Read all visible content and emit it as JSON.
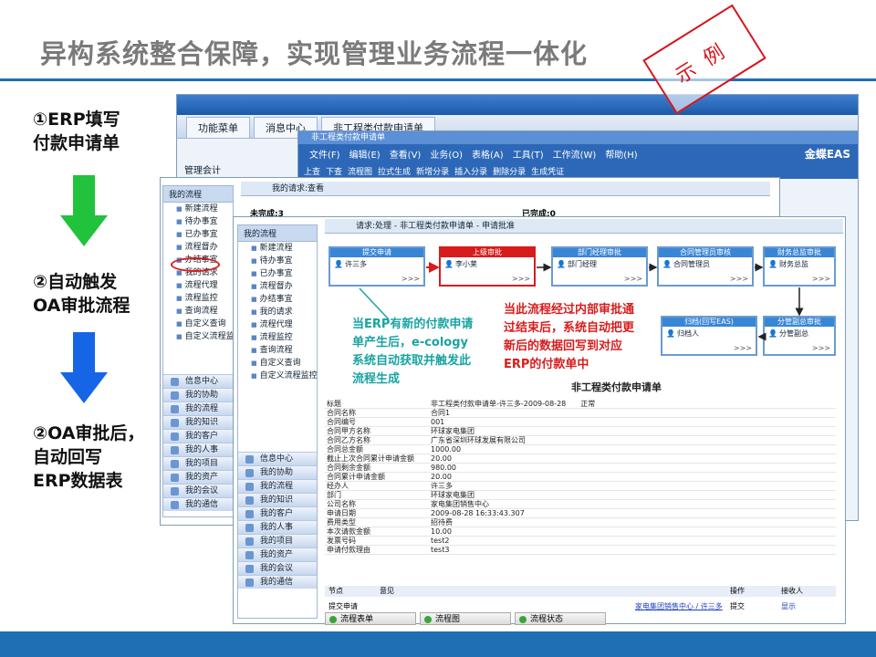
{
  "title": "异构系统整合保障，实现管理业务流程一体化",
  "stamp": "示例",
  "steps": [
    {
      "line1": "①ERP填写",
      "line2": "付款申请单"
    },
    {
      "line1": "②自动触发",
      "line2": "OA审批流程"
    },
    {
      "line1": "②OA审批后，",
      "line2": "自动回写",
      "line3": "ERP数据表"
    }
  ],
  "colors": {
    "accent": "#1f6fb5",
    "stamp": "#d8141b",
    "arrow_green": "#21c23c",
    "arrow_blue": "#1565e6"
  },
  "eas": {
    "tab_function": "功能菜单",
    "tab_message": "消息中心",
    "tab_form": "非工程类付款申请单",
    "inner_title": "非工程类付款申请单",
    "brand": "金蝶EAS",
    "section": "管理会计",
    "menu": [
      "文件(F)",
      "编辑(E)",
      "查看(V)",
      "业务(O)",
      "表格(A)",
      "工具(T)",
      "工作流(W)",
      "帮助(H)"
    ],
    "toolbar": [
      "上查",
      "下查",
      "流程图",
      "拉式生成",
      "新增分录",
      "插入分录",
      "删除分录",
      "生成凭证"
    ]
  },
  "oa_back": {
    "header": "我的请求:查看",
    "incomplete": "未完成:3",
    "complete": "已完成:0",
    "tree_title": "我的流程",
    "tree": [
      "新建流程",
      "待办事宜",
      "已办事宜",
      "流程督办",
      "办结事宜",
      "我的请求",
      "流程代理",
      "流程监控",
      "查询流程",
      "自定义查询",
      "自定义流程监控"
    ],
    "nav": [
      "信息中心",
      "我的协助",
      "我的流程",
      "我的知识",
      "我的客户",
      "我的人事",
      "我的项目",
      "我的资产",
      "我的会议",
      "我的通信"
    ]
  },
  "oa_front": {
    "header": "请求:处理 - 非工程类付款申请单 - 申请批准",
    "tree_title": "我的流程",
    "tree": [
      "新建流程",
      "待办事宜",
      "已办事宜",
      "流程督办",
      "办结事宜",
      "我的请求",
      "流程代理",
      "流程监控",
      "查询流程",
      "自定义查询",
      "自定义流程监控"
    ],
    "nav": [
      "信息中心",
      "我的协助",
      "我的流程",
      "我的知识",
      "我的客户",
      "我的人事",
      "我的项目",
      "我的资产",
      "我的会议",
      "我的通信"
    ],
    "nodes": [
      {
        "title": "提交申请",
        "person": "许三多"
      },
      {
        "title": "上级审批",
        "person": "李小莱"
      },
      {
        "title": "部门经理审批",
        "person": "部门经理"
      },
      {
        "title": "合同管理员审核",
        "person": "合同管理员"
      },
      {
        "title": "财务总监审批",
        "person": "财务总监"
      },
      {
        "title": "分管副总审批",
        "person": "分管副总"
      },
      {
        "title": "归档(回写EAS)",
        "person": "归档人"
      }
    ],
    "anno_left": [
      "当ERP有新的付款申请",
      "单产生后，e-cology",
      "系统自动获取并触发此",
      "流程生成"
    ],
    "anno_right": [
      "当此流程经过内部审批通",
      "过结束后，系统自动把更",
      "新后的数据回写到对应",
      "ERP的付款单中"
    ],
    "form_title": "非工程类付款申请单",
    "fields": [
      {
        "k": "标题",
        "v": "非工程类付款申请单-许三多-2009-08-28　　正常"
      },
      {
        "k": "合同名称",
        "v": "合同1"
      },
      {
        "k": "合同编号",
        "v": "001"
      },
      {
        "k": "合同甲方名称",
        "v": "环球家电集团"
      },
      {
        "k": "合同乙方名称",
        "v": "广东省深圳环球发展有限公司"
      },
      {
        "k": "合同总金额",
        "v": "1000.00"
      },
      {
        "k": "截止上次合同累计申请金额",
        "v": "20.00"
      },
      {
        "k": "合同剩余金额",
        "v": "980.00"
      },
      {
        "k": "合同累计申请金额",
        "v": "20.00"
      },
      {
        "k": "经办人",
        "v": "许三多"
      },
      {
        "k": "部门",
        "v": "环球家电集团"
      },
      {
        "k": "公司名称",
        "v": "家电集团销售中心"
      },
      {
        "k": "申请日期",
        "v": "2009-08-28 16:33:43.307"
      },
      {
        "k": "费用类型",
        "v": "招待费"
      },
      {
        "k": "本次请款金额",
        "v": "10.00"
      },
      {
        "k": "发票号码",
        "v": "test2"
      },
      {
        "k": "申请付款理由",
        "v": "test3"
      }
    ],
    "log_headers": {
      "node": "节点",
      "opinion": "意见",
      "op": "操作",
      "recv": "接收人"
    },
    "log_row": {
      "node": "提交申请",
      "link": "家电集团销售中心 / 许三多",
      "op": "提交",
      "recv": "显示"
    },
    "bottom_tabs": [
      "流程表单",
      "流程图",
      "流程状态"
    ]
  }
}
